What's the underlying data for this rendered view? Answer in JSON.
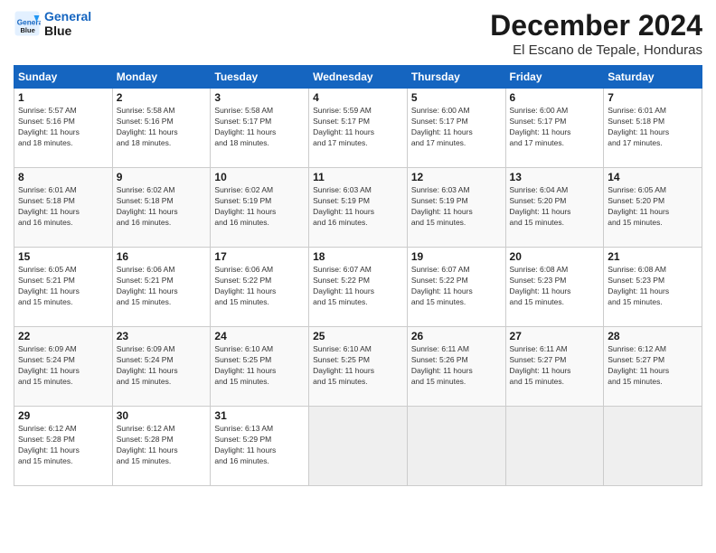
{
  "header": {
    "logo_line1": "General",
    "logo_line2": "Blue",
    "month": "December 2024",
    "location": "El Escano de Tepale, Honduras"
  },
  "weekdays": [
    "Sunday",
    "Monday",
    "Tuesday",
    "Wednesday",
    "Thursday",
    "Friday",
    "Saturday"
  ],
  "weeks": [
    [
      {
        "day": "1",
        "info": "Sunrise: 5:57 AM\nSunset: 5:16 PM\nDaylight: 11 hours\nand 18 minutes."
      },
      {
        "day": "2",
        "info": "Sunrise: 5:58 AM\nSunset: 5:16 PM\nDaylight: 11 hours\nand 18 minutes."
      },
      {
        "day": "3",
        "info": "Sunrise: 5:58 AM\nSunset: 5:17 PM\nDaylight: 11 hours\nand 18 minutes."
      },
      {
        "day": "4",
        "info": "Sunrise: 5:59 AM\nSunset: 5:17 PM\nDaylight: 11 hours\nand 17 minutes."
      },
      {
        "day": "5",
        "info": "Sunrise: 6:00 AM\nSunset: 5:17 PM\nDaylight: 11 hours\nand 17 minutes."
      },
      {
        "day": "6",
        "info": "Sunrise: 6:00 AM\nSunset: 5:17 PM\nDaylight: 11 hours\nand 17 minutes."
      },
      {
        "day": "7",
        "info": "Sunrise: 6:01 AM\nSunset: 5:18 PM\nDaylight: 11 hours\nand 17 minutes."
      }
    ],
    [
      {
        "day": "8",
        "info": "Sunrise: 6:01 AM\nSunset: 5:18 PM\nDaylight: 11 hours\nand 16 minutes."
      },
      {
        "day": "9",
        "info": "Sunrise: 6:02 AM\nSunset: 5:18 PM\nDaylight: 11 hours\nand 16 minutes."
      },
      {
        "day": "10",
        "info": "Sunrise: 6:02 AM\nSunset: 5:19 PM\nDaylight: 11 hours\nand 16 minutes."
      },
      {
        "day": "11",
        "info": "Sunrise: 6:03 AM\nSunset: 5:19 PM\nDaylight: 11 hours\nand 16 minutes."
      },
      {
        "day": "12",
        "info": "Sunrise: 6:03 AM\nSunset: 5:19 PM\nDaylight: 11 hours\nand 15 minutes."
      },
      {
        "day": "13",
        "info": "Sunrise: 6:04 AM\nSunset: 5:20 PM\nDaylight: 11 hours\nand 15 minutes."
      },
      {
        "day": "14",
        "info": "Sunrise: 6:05 AM\nSunset: 5:20 PM\nDaylight: 11 hours\nand 15 minutes."
      }
    ],
    [
      {
        "day": "15",
        "info": "Sunrise: 6:05 AM\nSunset: 5:21 PM\nDaylight: 11 hours\nand 15 minutes."
      },
      {
        "day": "16",
        "info": "Sunrise: 6:06 AM\nSunset: 5:21 PM\nDaylight: 11 hours\nand 15 minutes."
      },
      {
        "day": "17",
        "info": "Sunrise: 6:06 AM\nSunset: 5:22 PM\nDaylight: 11 hours\nand 15 minutes."
      },
      {
        "day": "18",
        "info": "Sunrise: 6:07 AM\nSunset: 5:22 PM\nDaylight: 11 hours\nand 15 minutes."
      },
      {
        "day": "19",
        "info": "Sunrise: 6:07 AM\nSunset: 5:22 PM\nDaylight: 11 hours\nand 15 minutes."
      },
      {
        "day": "20",
        "info": "Sunrise: 6:08 AM\nSunset: 5:23 PM\nDaylight: 11 hours\nand 15 minutes."
      },
      {
        "day": "21",
        "info": "Sunrise: 6:08 AM\nSunset: 5:23 PM\nDaylight: 11 hours\nand 15 minutes."
      }
    ],
    [
      {
        "day": "22",
        "info": "Sunrise: 6:09 AM\nSunset: 5:24 PM\nDaylight: 11 hours\nand 15 minutes."
      },
      {
        "day": "23",
        "info": "Sunrise: 6:09 AM\nSunset: 5:24 PM\nDaylight: 11 hours\nand 15 minutes."
      },
      {
        "day": "24",
        "info": "Sunrise: 6:10 AM\nSunset: 5:25 PM\nDaylight: 11 hours\nand 15 minutes."
      },
      {
        "day": "25",
        "info": "Sunrise: 6:10 AM\nSunset: 5:25 PM\nDaylight: 11 hours\nand 15 minutes."
      },
      {
        "day": "26",
        "info": "Sunrise: 6:11 AM\nSunset: 5:26 PM\nDaylight: 11 hours\nand 15 minutes."
      },
      {
        "day": "27",
        "info": "Sunrise: 6:11 AM\nSunset: 5:27 PM\nDaylight: 11 hours\nand 15 minutes."
      },
      {
        "day": "28",
        "info": "Sunrise: 6:12 AM\nSunset: 5:27 PM\nDaylight: 11 hours\nand 15 minutes."
      }
    ],
    [
      {
        "day": "29",
        "info": "Sunrise: 6:12 AM\nSunset: 5:28 PM\nDaylight: 11 hours\nand 15 minutes."
      },
      {
        "day": "30",
        "info": "Sunrise: 6:12 AM\nSunset: 5:28 PM\nDaylight: 11 hours\nand 15 minutes."
      },
      {
        "day": "31",
        "info": "Sunrise: 6:13 AM\nSunset: 5:29 PM\nDaylight: 11 hours\nand 16 minutes."
      },
      {
        "day": "",
        "info": ""
      },
      {
        "day": "",
        "info": ""
      },
      {
        "day": "",
        "info": ""
      },
      {
        "day": "",
        "info": ""
      }
    ]
  ]
}
